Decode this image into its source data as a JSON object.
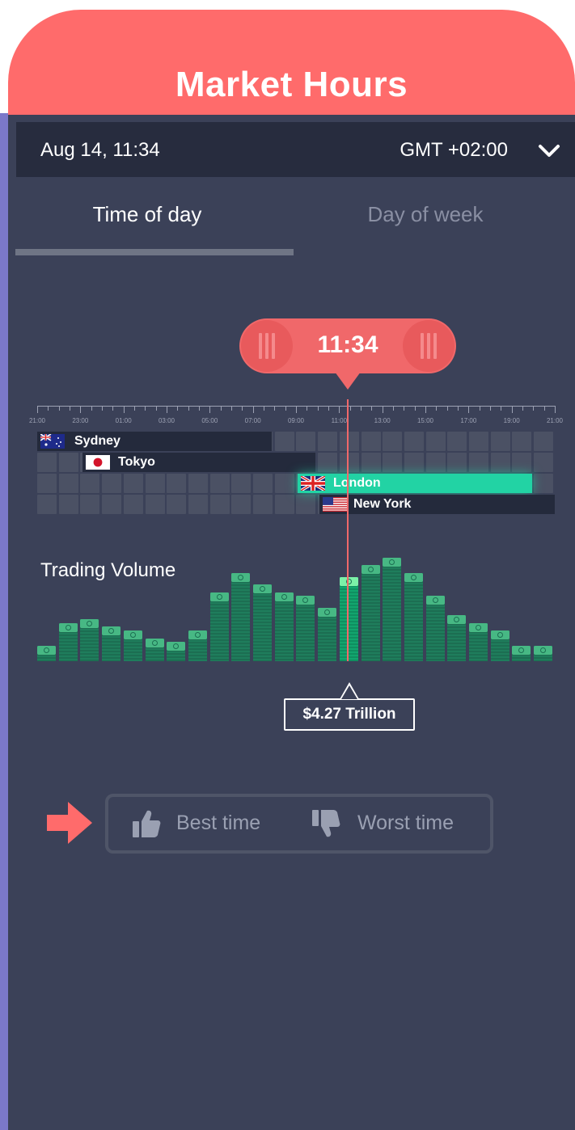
{
  "header": {
    "title": "Market Hours",
    "color": "#ff6b6b"
  },
  "timebar": {
    "date": "Aug 14, 11:34",
    "timezone": "GMT +02:00",
    "dropdown_icon": "chevron-down-icon"
  },
  "tabs": [
    {
      "label": "Time of day",
      "active": true
    },
    {
      "label": "Day of week",
      "active": false
    }
  ],
  "slider": {
    "time": "11:34"
  },
  "ruler": {
    "labels": [
      "21:00",
      "23:00",
      "01:00",
      "03:00",
      "05:00",
      "07:00",
      "09:00",
      "11:00",
      "13:00",
      "15:00",
      "17:00",
      "19:00",
      "21:00"
    ]
  },
  "sessions": [
    {
      "name": "Sydney",
      "flag": "flag-au-icon"
    },
    {
      "name": "Tokyo",
      "flag": "flag-jp-icon"
    },
    {
      "name": "London",
      "flag": "flag-uk-icon",
      "active": true,
      "color": "#22d3a4"
    },
    {
      "name": "New York",
      "flag": "flag-us-icon"
    }
  ],
  "volume": {
    "title": "Trading Volume",
    "current_value": "$4.27 Trillion"
  },
  "chart_data": {
    "type": "bar",
    "title": "Trading Volume",
    "values": [
      2,
      5,
      5.5,
      4.5,
      4,
      3,
      2.5,
      4,
      9,
      11.5,
      10,
      9,
      8.5,
      7,
      11,
      12.5,
      13.5,
      11.5,
      8.5,
      6,
      5,
      4,
      2,
      2
    ],
    "highlight_index": 14
  },
  "rating": {
    "best_label": "Best time",
    "worst_label": "Worst time",
    "arrow_color": "#ff6b6b"
  }
}
